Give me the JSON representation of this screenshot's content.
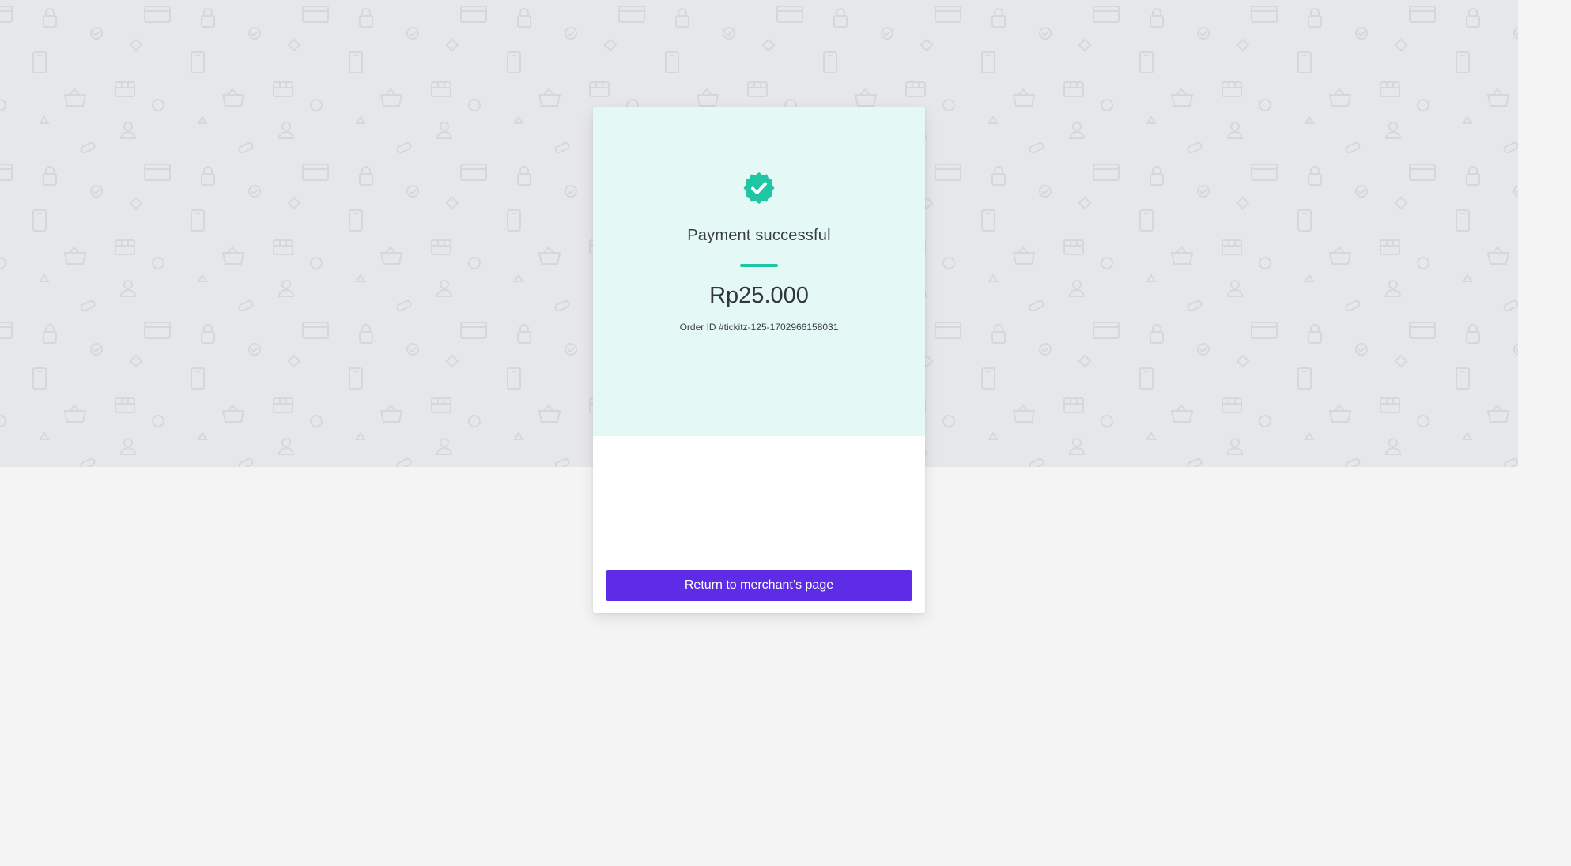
{
  "payment": {
    "status_title": "Payment successful",
    "amount": "Rp25.000",
    "order_id": "Order ID #tickitz-125-1702966158031",
    "status_icon": "verified-check-badge-icon"
  },
  "actions": {
    "return_label": "Return to merchant’s page"
  },
  "colors": {
    "background_pattern": "#e6e7e9",
    "page_background": "#f4f4f4",
    "card_top": "#e4f9f5",
    "success_accent": "#1ec6a4",
    "primary_button": "#5e2ce6"
  },
  "background_icons": [
    "lock-icon",
    "credit-card-icon",
    "check-circle-icon",
    "diamond-icon",
    "phone-icon",
    "store-icon",
    "basket-icon",
    "user-icon",
    "circle-icon",
    "triangle-icon",
    "pill-icon"
  ]
}
